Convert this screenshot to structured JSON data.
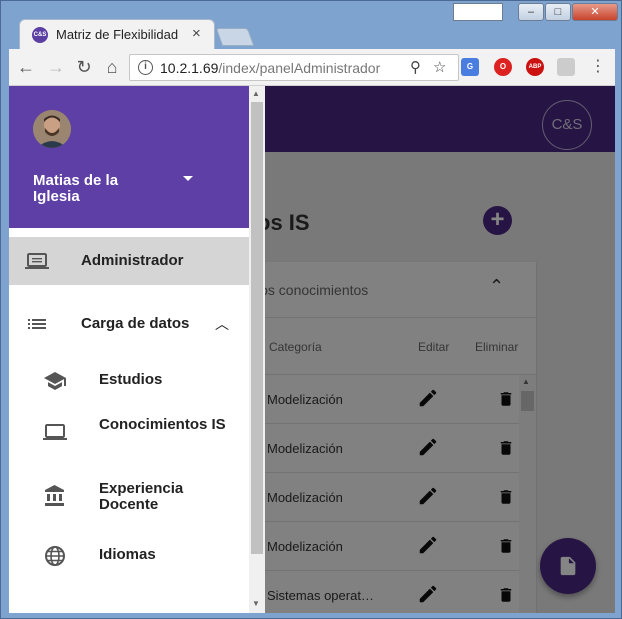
{
  "browser": {
    "tab_title": "Matriz de Flexibilidad",
    "tab_close": "×",
    "url_host": "10.2.1.69",
    "url_path": "/index/panelAdministrador",
    "favicon_text": "C&S",
    "extensions": [
      "G",
      "O",
      "ABP"
    ]
  },
  "app": {
    "logo": "C&S",
    "title_fragment": "os IS",
    "card": {
      "title_fragment": "los conocimientos",
      "columns": {
        "category": "Categoría",
        "edit": "Editar",
        "delete": "Eliminar"
      },
      "rows": [
        {
          "category": "Modelización"
        },
        {
          "category": "Modelización"
        },
        {
          "category": "Modelización"
        },
        {
          "category": "Modelización"
        },
        {
          "category": "Sistemas operat…"
        }
      ]
    }
  },
  "drawer": {
    "user_name": "Matias de la Iglesia",
    "items": [
      {
        "label": "Administrador",
        "icon": "computer-icon",
        "active": true
      },
      {
        "label": "Carga de datos",
        "icon": "list-icon",
        "expanded": true
      }
    ],
    "subitems": [
      {
        "label": "Estudios",
        "icon": "school-icon"
      },
      {
        "label": "Conocimientos IS",
        "icon": "laptop-icon"
      },
      {
        "label": "Experiencia Docente",
        "icon": "bank-icon"
      },
      {
        "label": "Idiomas",
        "icon": "globe-icon"
      }
    ]
  },
  "colors": {
    "primary": "#4a2a82",
    "drawer_header": "#5d3fa5",
    "active_item": "#d5d5d5"
  }
}
